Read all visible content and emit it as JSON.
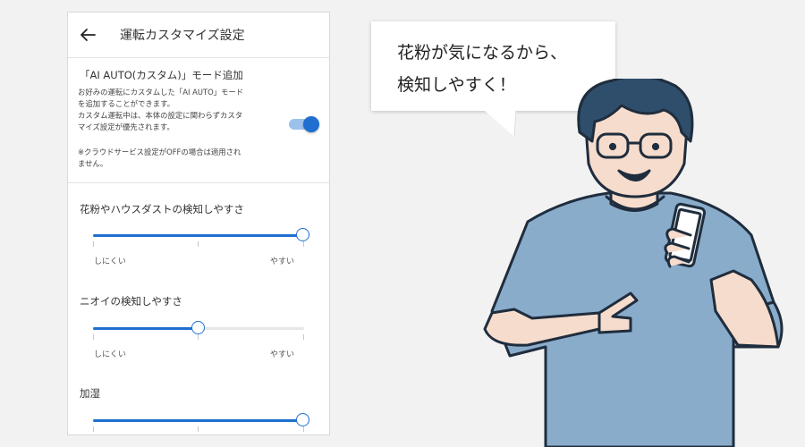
{
  "settings_panel": {
    "title": "運転カスタマイズ設定",
    "back_icon": "arrow-left-icon",
    "custom_mode": {
      "title": "「AI AUTO(カスタム)」モード追加",
      "desc_lines": [
        "お好みの運転にカスタムした「AI AUTO」モード",
        "を追加することができます。",
        "カスタム運転中は、本体の設定に関わらずカスタ",
        "マイズ設定が優先されます。"
      ],
      "note_lines": [
        "※クラウドサービス設定がOFFの場合は適用され",
        "ません。"
      ],
      "toggle_on": true,
      "accent_color": "#1f6fd1"
    },
    "sliders": [
      {
        "label": "花粉やハウスダストの検知しやすさ",
        "min_label": "しにくい",
        "max_label": "やすい",
        "value": 1.0
      },
      {
        "label": "ニオイの検知しやすさ",
        "min_label": "しにくい",
        "max_label": "やすい",
        "value": 0.5
      },
      {
        "label": "加湿",
        "min_label": "",
        "max_label": "",
        "value": 1.0
      }
    ]
  },
  "bubble": {
    "lines": [
      "花粉が気になるから、",
      "検知しやすく！"
    ]
  }
}
